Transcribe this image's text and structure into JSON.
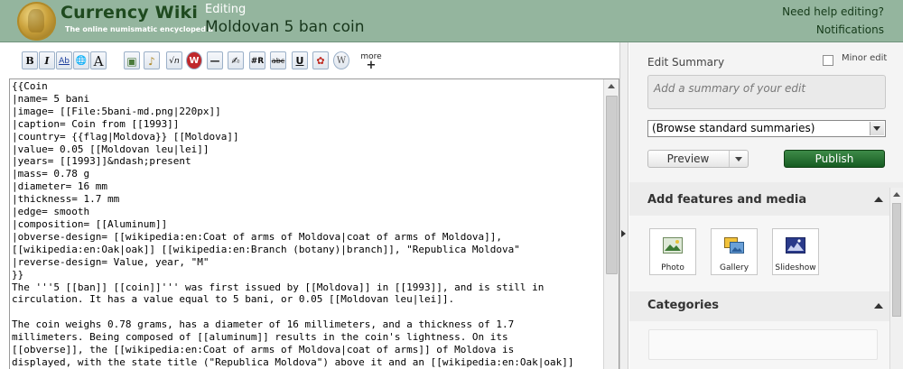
{
  "header": {
    "logo_title": "Currency Wiki",
    "logo_tagline": "The online numismatic encyclopedia",
    "editing_label": "Editing",
    "page_title": "Moldovan 5 ban coin",
    "help_link": "Need help editing?",
    "notifications_link": "Notifications"
  },
  "toolbar": {
    "buttons": [
      {
        "label": "B",
        "icon": "bold-icon"
      },
      {
        "label": "I",
        "icon": "italic-icon"
      },
      {
        "label": "Ab",
        "icon": "internal-link-icon"
      },
      {
        "label": "🌐",
        "icon": "external-link-icon"
      },
      {
        "label": "A",
        "icon": "heading-icon"
      },
      {
        "label": "▣",
        "icon": "image-icon"
      },
      {
        "label": "♪",
        "icon": "media-icon"
      },
      {
        "label": "√n",
        "icon": "math-icon"
      },
      {
        "label": "W",
        "icon": "nowiki-icon"
      },
      {
        "label": "—",
        "icon": "horizontal-line-icon"
      },
      {
        "label": "✍",
        "icon": "signature-icon"
      },
      {
        "label": "#R",
        "icon": "redirect-icon"
      },
      {
        "label": "abc",
        "icon": "strikethrough-icon"
      },
      {
        "label": "U",
        "icon": "underline-icon"
      },
      {
        "label": "✿",
        "icon": "gallery-insert-icon"
      },
      {
        "label": "W",
        "icon": "wikipedia-icon"
      }
    ],
    "more_label": "more",
    "more_plus": "+"
  },
  "editor": {
    "content": "{{Coin\n|name= 5 bani\n|image= [[File:5bani-md.png|220px]]\n|caption= Coin from [[1993]]\n|country= {{flag|Moldova}} [[Moldova]]\n|value= 0.05 [[Moldovan leu|lei]]\n|years= [[1993]]&ndash;present\n|mass= 0.78 g\n|diameter= 16 mm\n|thickness= 1.7 mm\n|edge= smooth\n|composition= [[Aluminum]]\n|obverse-design= [[wikipedia:en:Coat of arms of Moldova|coat of arms of Moldova]],\n[[wikipedia:en:Oak|oak]] [[wikipedia:en:Branch (botany)|branch]], \"Republica Moldova\"\n|reverse-design= Value, year, \"M\"\n}}\nThe '''5 [[ban]] [[coin]]''' was first issued by [[Moldova]] in [[1993]], and is still in\ncirculation. It has a value equal to 5 bani, or 0.05 [[Moldovan leu|lei]].\n\nThe coin weighs 0.78 grams, has a diameter of 16 millimeters, and a thickness of 1.7\nmillimeters. Being composed of [[aluminum]] results in the coin's lightness. On its\n[[obverse]], the [[wikipedia:en:Coat of arms of Moldova|coat of arms]] of Moldova is\ndisplayed, with the state title (\"Republica Moldova\") above it and an [[wikipedia:en:Oak|oak]]"
  },
  "sidebar": {
    "edit_summary_label": "Edit Summary",
    "minor_edit_label": "Minor edit",
    "summary_placeholder": "Add a summary of your edit",
    "browse_select_value": "(Browse standard summaries)",
    "preview_label": "Preview",
    "publish_label": "Publish",
    "features_title": "Add features and media",
    "media_buttons": [
      {
        "label": "Photo",
        "icon": "photo-icon"
      },
      {
        "label": "Gallery",
        "icon": "gallery-icon"
      },
      {
        "label": "Slideshow",
        "icon": "slideshow-icon"
      }
    ],
    "categories_title": "Categories"
  },
  "colors": {
    "header_bg": "#94b59e",
    "publish_bg": "#1d6a2a",
    "brand_text": "#1f4a1f"
  }
}
